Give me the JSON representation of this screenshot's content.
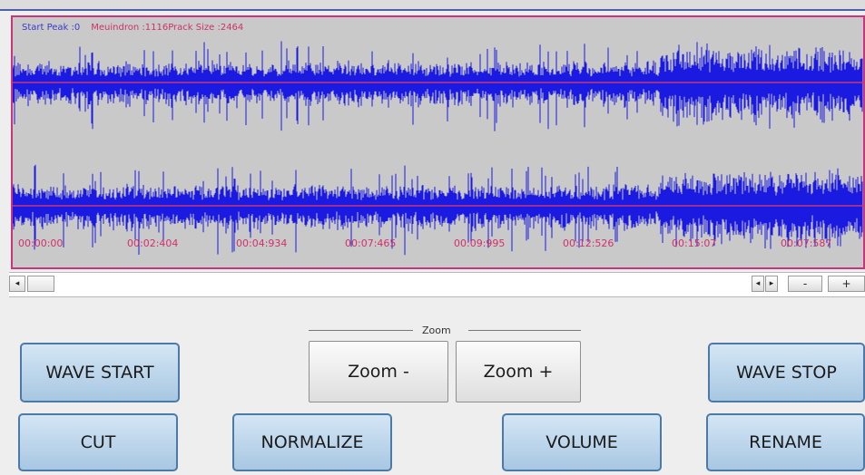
{
  "waveform": {
    "start_peak": "Start Peak :0",
    "info_detail": "Meuindron :1116Prack Size :2464",
    "timecodes": [
      "00:00:00",
      "00:02:404",
      "00:04:934",
      "00:07:465",
      "00:09:995",
      "00:12:526",
      "00:15:07",
      "00:07:587"
    ],
    "colors": {
      "background": "#c9c9c9",
      "wave": "#1a1ae0",
      "marker": "#c8357a",
      "border": "#c8357a"
    }
  },
  "scrollbar": {
    "left_arrow": "◂",
    "right_nav_left": "◂",
    "right_nav_right": "▸",
    "zoom_minus_small": "-",
    "zoom_plus_small": "+"
  },
  "zoom_group": {
    "label": "Zoom"
  },
  "buttons": {
    "wave_start": "WAVE START",
    "zoom_minus": "Zoom -",
    "zoom_plus": "Zoom +",
    "wave_stop": "WAVE STOP",
    "cut": "CUT",
    "normalize": "NORMALIZE",
    "volume": "VOLUME",
    "rename": "RENAME"
  }
}
